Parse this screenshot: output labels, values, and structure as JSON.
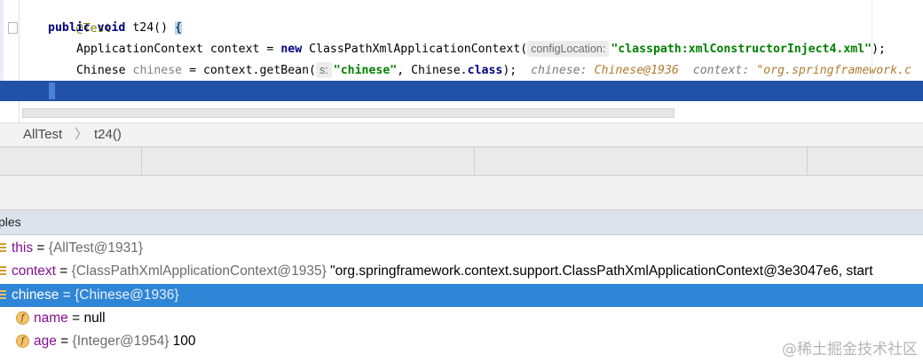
{
  "editor": {
    "lines": {
      "annotation": "@Test",
      "method": {
        "kw_public": "public",
        "kw_void": "void",
        "name": "t24()",
        "brace": "{"
      },
      "line3": {
        "type": "ApplicationContext",
        "var": "context",
        "eq": "=",
        "kw_new": "new",
        "ctor": "ClassPathXmlApplicationContext(",
        "hint": "configLocation:",
        "arg": "\"classpath:xmlConstructorInject4.xml\"",
        "tail": ");"
      },
      "line4": {
        "type": "Chinese",
        "var": "chinese",
        "eq": "=",
        "call": "context.getBean(",
        "hint": "s:",
        "arg": "\"chinese\"",
        "mid": ", Chinese.",
        "kw_class": "class",
        "tail": ");",
        "inline1_name": "chinese:",
        "inline1_val": "Chinese@1936",
        "inline2_name": "context:",
        "inline2_val": "\"org.springframework.c"
      },
      "closing": "}"
    }
  },
  "breadcrumb": {
    "class_name": "AllTest",
    "separator": "〉",
    "method_name": "t24()"
  },
  "variables": {
    "header": "ples",
    "rows": [
      {
        "name": "this",
        "eq": " = ",
        "type": "{AllTest@1931}",
        "value": ""
      },
      {
        "name": "context",
        "eq": " = ",
        "type": "{ClassPathXmlApplicationContext@1935}",
        "value": " \"org.springframework.context.support.ClassPathXmlApplicationContext@3e3047e6, start"
      },
      {
        "name": "chinese",
        "eq": " = ",
        "type": "{Chinese@1936}",
        "value": ""
      },
      {
        "name": "name",
        "eq": " = ",
        "type": "",
        "value": "null"
      },
      {
        "name": "age",
        "eq": " = ",
        "type": "{Integer@1954}",
        "value": " 100"
      }
    ]
  },
  "watermark": "@稀土掘金技术社区",
  "icons": {
    "field": "f"
  },
  "colors": {
    "selection": "#2152a8",
    "var_selected": "#2f86d6",
    "keyword": "#000080",
    "string": "#008000"
  }
}
